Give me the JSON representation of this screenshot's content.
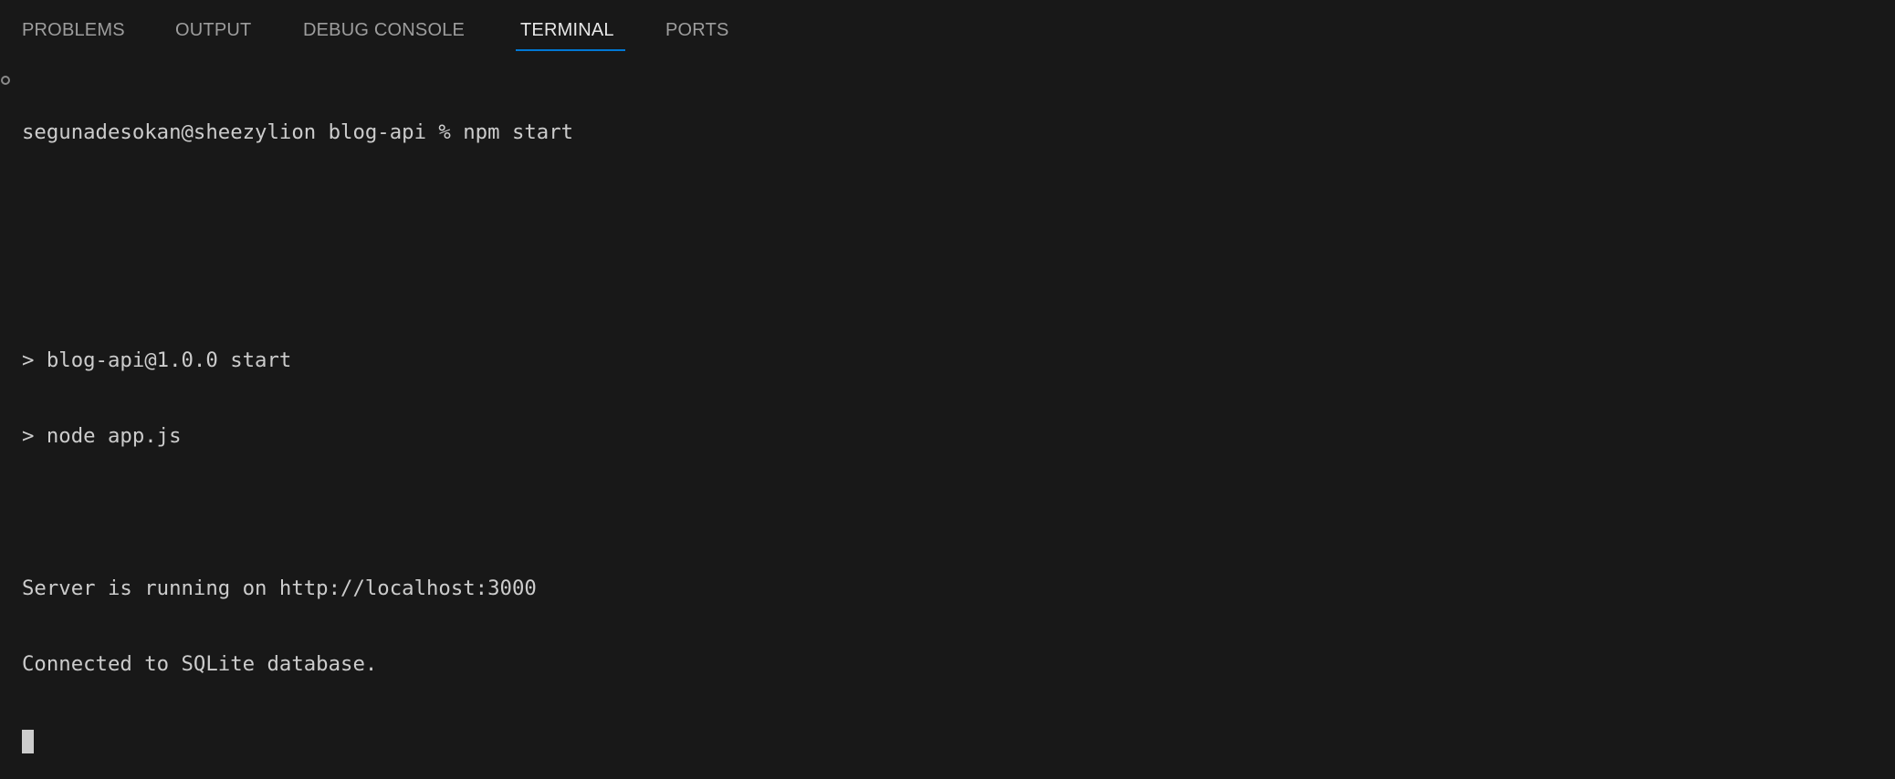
{
  "panel": {
    "tabs": [
      {
        "label": "PROBLEMS",
        "active": false
      },
      {
        "label": "OUTPUT",
        "active": false
      },
      {
        "label": "DEBUG CONSOLE",
        "active": false
      },
      {
        "label": "TERMINAL",
        "active": true
      },
      {
        "label": "PORTS",
        "active": false
      }
    ]
  },
  "terminal": {
    "lines": [
      "segunadesokan@sheezylion blog-api % npm start",
      "",
      "",
      "> blog-api@1.0.0 start",
      "> node app.js",
      "",
      "Server is running on http://localhost:3000",
      "Connected to SQLite database."
    ]
  },
  "colors": {
    "background": "#181818",
    "accent": "#0078d4",
    "text": "#cccccc"
  }
}
